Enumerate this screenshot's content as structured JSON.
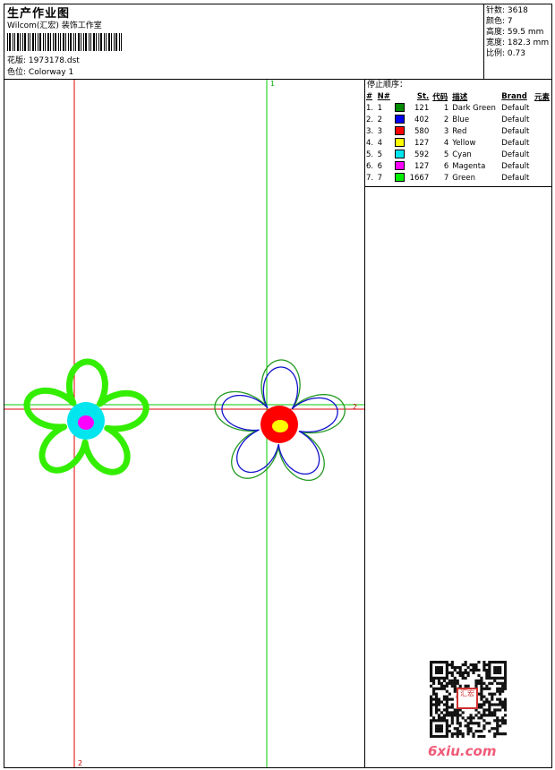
{
  "header": {
    "title": "生产作业图",
    "studio": "Wilcom(汇宏) 装饰工作室",
    "design_label": "花版",
    "design_file": "1973178.dst",
    "colorway_label": "色位",
    "colorway": "Colorway 1"
  },
  "stats": {
    "stitches_label": "针数",
    "stitches": "3618",
    "colors_label": "颜色",
    "colors": "7",
    "height_label": "高度",
    "height": "59.5 mm",
    "width_label": "宽度",
    "width": "182.3 mm",
    "scale_label": "比例",
    "scale": "0.73"
  },
  "stop_sequence": {
    "title": "停止顺序：",
    "columns": [
      "#",
      "N#",
      "",
      "St.",
      "代码",
      "描述",
      "Brand",
      "元素"
    ],
    "rows": [
      {
        "idx": "1.",
        "n": "1",
        "color": "#008a00",
        "st": "121",
        "code": "1",
        "desc": "Dark Green",
        "brand": "Default"
      },
      {
        "idx": "2.",
        "n": "2",
        "color": "#0000ee",
        "st": "402",
        "code": "2",
        "desc": "Blue",
        "brand": "Default"
      },
      {
        "idx": "3.",
        "n": "3",
        "color": "#ff0000",
        "st": "580",
        "code": "3",
        "desc": "Red",
        "brand": "Default"
      },
      {
        "idx": "4.",
        "n": "4",
        "color": "#ffff00",
        "st": "127",
        "code": "4",
        "desc": "Yellow",
        "brand": "Default"
      },
      {
        "idx": "5.",
        "n": "5",
        "color": "#00e5ee",
        "st": "592",
        "code": "5",
        "desc": "Cyan",
        "brand": "Default"
      },
      {
        "idx": "6.",
        "n": "6",
        "color": "#ff00ff",
        "st": "127",
        "code": "6",
        "desc": "Magenta",
        "brand": "Default"
      },
      {
        "idx": "7.",
        "n": "7",
        "color": "#00ee00",
        "st": "1667",
        "code": "7",
        "desc": "Green",
        "brand": "Default"
      }
    ]
  },
  "canvas": {
    "marker_top": "1",
    "marker_bottom": "2",
    "marker_right": "2"
  },
  "watermark": {
    "text": "6xiu.com",
    "seal_text": "汇宏"
  },
  "colors": {
    "guide_red": "#e00000",
    "guide_green": "#00cc00",
    "flower_green": "#33ee00",
    "outline_green": "#229922",
    "outline_blue": "#1111cc"
  }
}
